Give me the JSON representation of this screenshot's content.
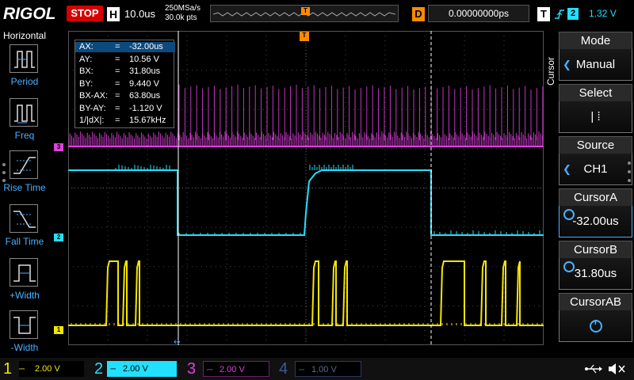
{
  "header": {
    "brand": "RIGOL",
    "run_state": "STOP",
    "timebase_letter": "H",
    "timebase": "10.0us",
    "sample_rate": "250MSa/s",
    "memory_depth": "30.0k pts",
    "memory_trigger_marker": "T",
    "delay_letter": "D",
    "delay": "0.00000000ps",
    "trigger_letter": "T",
    "trigger_source": "2",
    "trigger_level": "1.32 V"
  },
  "left_menu": {
    "title": "Horizontal",
    "items": [
      {
        "label": "Period"
      },
      {
        "label": "Freq"
      },
      {
        "label": "Rise Time"
      },
      {
        "label": "Fall Time"
      },
      {
        "label": "+Width"
      },
      {
        "label": "-Width"
      }
    ]
  },
  "cursor_readout": [
    {
      "key": "AX:",
      "eq": "=",
      "value": "-32.00us"
    },
    {
      "key": "AY:",
      "eq": "=",
      "value": "10.56 V"
    },
    {
      "key": "BX:",
      "eq": "=",
      "value": "31.80us"
    },
    {
      "key": "BY:",
      "eq": "=",
      "value": "9.440 V"
    },
    {
      "key": "BX-AX:",
      "eq": "=",
      "value": "63.80us"
    },
    {
      "key": "BY-AY:",
      "eq": "=",
      "value": "-1.120 V"
    },
    {
      "key": "1/|dX|:",
      "eq": "=",
      "value": "15.67kHz"
    }
  ],
  "markers": {
    "ch1": "1",
    "ch2": "2",
    "ch3": "3",
    "trigger_pos": "T",
    "trigger_level": "T"
  },
  "right_menu": {
    "side_title": "Cursor",
    "blocks": [
      {
        "title": "Mode",
        "value": "Manual"
      },
      {
        "title": "Select",
        "value": "| ⁞"
      },
      {
        "title": "Source",
        "value": "CH1"
      },
      {
        "title": "CursorA",
        "value": "-32.00us"
      },
      {
        "title": "CursorB",
        "value": "31.80us"
      },
      {
        "title": "CursorAB",
        "value": ""
      }
    ]
  },
  "channels": [
    {
      "num": "1",
      "coupling": "⎓",
      "scale": "2.00 V",
      "color": "#f5e600"
    },
    {
      "num": "2",
      "coupling": "⎓",
      "scale": "2.00 V",
      "color": "#22e0ff"
    },
    {
      "num": "3",
      "coupling": "⎓",
      "scale": "2.00 V",
      "color": "#e040e0"
    },
    {
      "num": "4",
      "coupling": "⎓",
      "scale": "1.00 V",
      "color": "#3a5aa0"
    }
  ],
  "colors": {
    "ch1": "#f5e600",
    "ch2": "#22e0ff",
    "ch3": "#e040e0",
    "ch4": "#3a5aa0",
    "trigger": "#ff8a00",
    "accent": "#4ab0ff",
    "stop": "#d40000"
  }
}
